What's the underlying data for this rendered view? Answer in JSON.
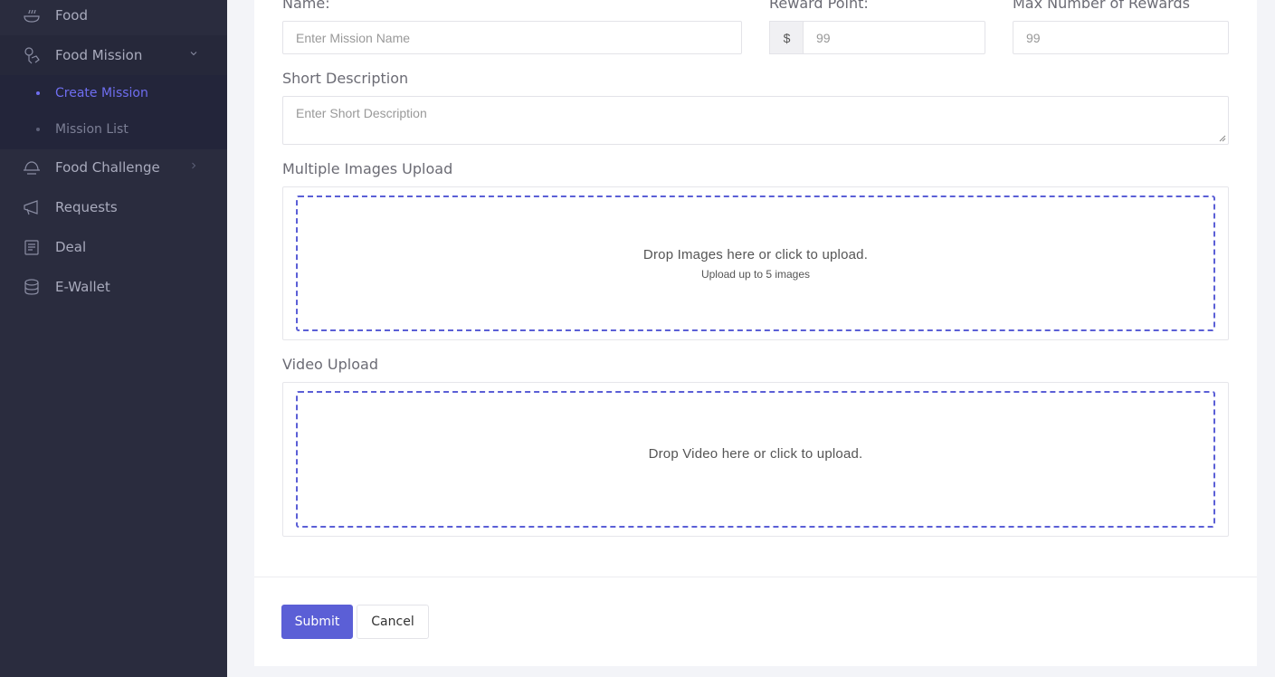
{
  "sidebar": {
    "items": [
      {
        "label": "Food",
        "icon": "food-bowl-icon"
      },
      {
        "label": "Food Mission",
        "icon": "mission-icon"
      },
      {
        "label": "Food Challenge",
        "icon": "challenge-icon"
      },
      {
        "label": "Requests",
        "icon": "megaphone-icon"
      },
      {
        "label": "Deal",
        "icon": "deal-icon"
      },
      {
        "label": "E-Wallet",
        "icon": "coins-icon"
      }
    ],
    "sub_items": [
      {
        "label": "Create Mission",
        "active": true
      },
      {
        "label": "Mission List",
        "active": false
      }
    ]
  },
  "form": {
    "name_label": "Name:",
    "name_placeholder": "Enter Mission Name",
    "reward_label": "Reward Point:",
    "reward_prefix": "$",
    "reward_placeholder": "99",
    "max_rewards_label": "Max Number of Rewards",
    "max_rewards_placeholder": "99",
    "short_desc_label": "Short Description",
    "short_desc_placeholder": "Enter Short Description",
    "images_label": "Multiple Images Upload",
    "images_drop_text": "Drop Images here or click to upload.",
    "images_drop_sub": "Upload up to 5 images",
    "video_label": "Video Upload",
    "video_drop_text": "Drop Video here or click to upload."
  },
  "actions": {
    "submit_label": "Submit",
    "cancel_label": "Cancel"
  },
  "colors": {
    "accent": "#5b5fd6",
    "sidebar_bg": "#2a2c3e",
    "active_link": "#6f6ef0"
  }
}
